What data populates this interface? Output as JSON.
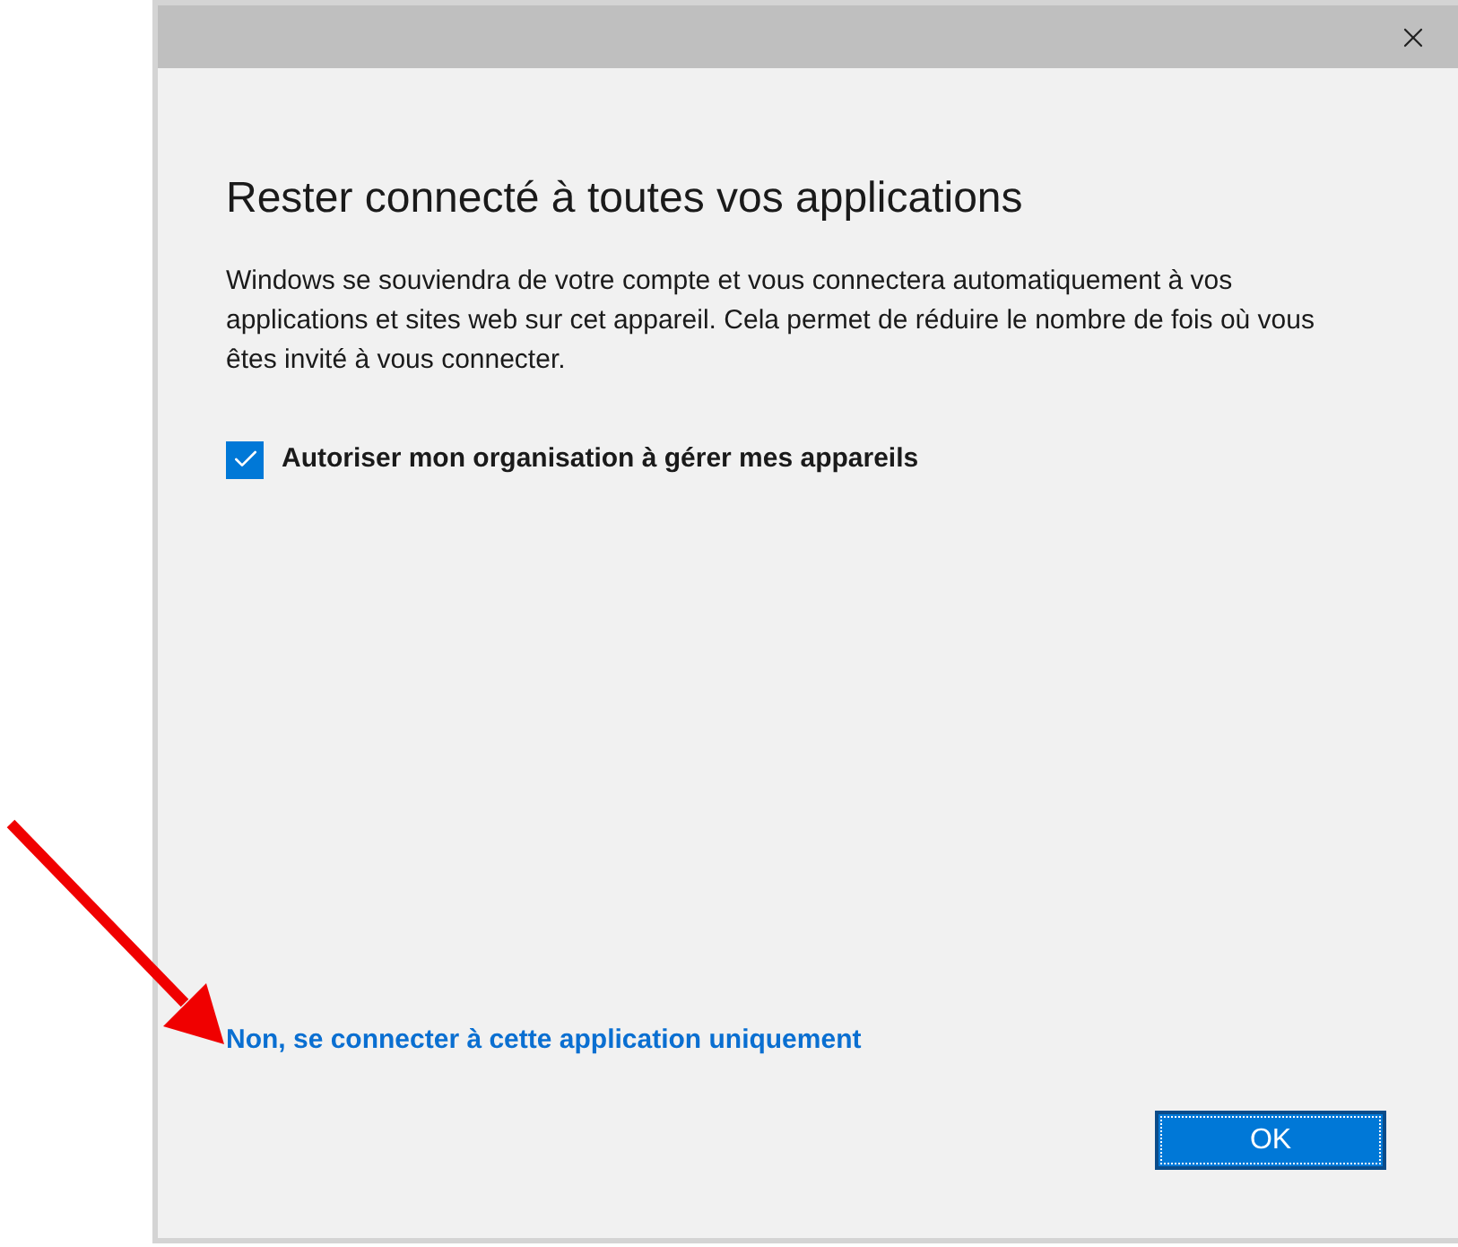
{
  "dialog": {
    "heading": "Rester connecté à toutes vos applications",
    "description": "Windows se souviendra de votre compte et vous connectera automatiquement à vos applications et sites web sur cet appareil. Cela permet de réduire le nombre de fois où vous êtes invité à vous connecter.",
    "checkbox": {
      "label": "Autoriser mon organisation à gérer mes appareils",
      "checked": true
    },
    "link": "Non, se connecter à cette application uniquement",
    "button": "OK"
  }
}
